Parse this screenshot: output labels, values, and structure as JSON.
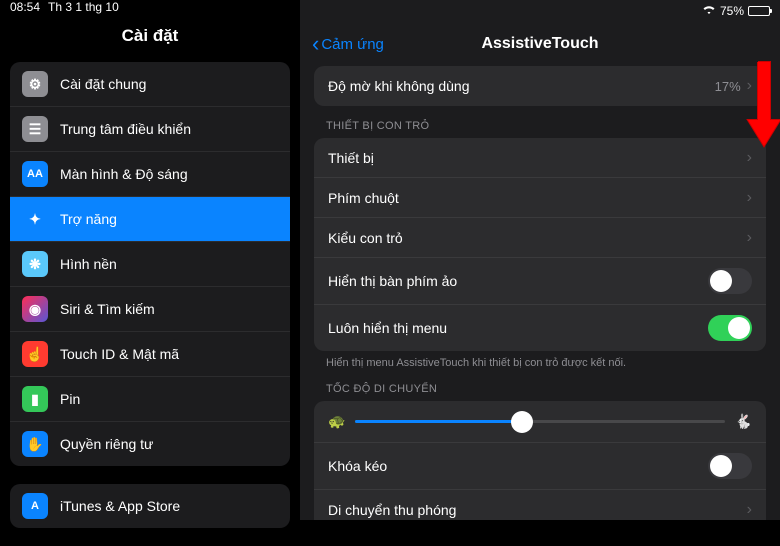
{
  "status": {
    "time": "08:54",
    "date": "Th 3 1 thg 10",
    "battery_percent": "75%"
  },
  "sidebar": {
    "title": "Cài đặt",
    "groups": [
      {
        "items": [
          {
            "label": "Cài đặt chung",
            "icon": "gear",
            "color": "ic-gray"
          },
          {
            "label": "Trung tâm điều khiển",
            "icon": "switches",
            "color": "ic-gray"
          },
          {
            "label": "Màn hình & Độ sáng",
            "icon": "AA",
            "color": "ic-blue"
          },
          {
            "label": "Trợ năng",
            "icon": "person",
            "color": "ic-blue",
            "selected": true
          },
          {
            "label": "Hình nền",
            "icon": "flower",
            "color": "ic-teal"
          },
          {
            "label": "Siri & Tìm kiếm",
            "icon": "siri",
            "color": "ic-purple"
          },
          {
            "label": "Touch ID & Mật mã",
            "icon": "finger",
            "color": "ic-red"
          },
          {
            "label": "Pin",
            "icon": "battery",
            "color": "ic-green"
          },
          {
            "label": "Quyền riêng tư",
            "icon": "hand",
            "color": "ic-blue"
          }
        ]
      },
      {
        "items": [
          {
            "label": "iTunes & App Store",
            "icon": "A",
            "color": "ic-blue"
          }
        ]
      }
    ]
  },
  "main": {
    "back_label": "Cảm ứng",
    "title": "AssistiveTouch",
    "sections": [
      {
        "rows": [
          {
            "label": "Độ mờ khi không dùng",
            "value": "17%",
            "type": "chevron"
          }
        ]
      },
      {
        "header": "THIẾT BỊ CON TRỎ",
        "footer": "Hiển thị menu AssistiveTouch khi thiết bị con trỏ được kết nối.",
        "rows": [
          {
            "label": "Thiết bị",
            "type": "chevron"
          },
          {
            "label": "Phím chuột",
            "type": "chevron"
          },
          {
            "label": "Kiểu con trỏ",
            "type": "chevron"
          },
          {
            "label": "Hiển thị bàn phím ảo",
            "type": "toggle",
            "on": false
          },
          {
            "label": "Luôn hiển thị menu",
            "type": "toggle",
            "on": true
          }
        ]
      },
      {
        "header": "TỐC ĐỘ DI CHUYỂN",
        "rows": [
          {
            "type": "slider",
            "value": 45
          },
          {
            "label": "Khóa kéo",
            "type": "toggle",
            "on": false
          },
          {
            "label": "Di chuyển thu phóng",
            "type": "chevron"
          }
        ]
      }
    ]
  }
}
